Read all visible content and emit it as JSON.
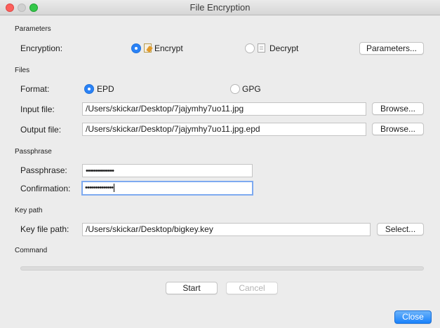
{
  "window": {
    "title": "File Encryption"
  },
  "parameters": {
    "section_label": "Parameters",
    "encryption_label": "Encryption:",
    "encrypt_option": "Encrypt",
    "decrypt_option": "Decrypt",
    "selected": "Encrypt",
    "parameters_button": "Parameters..."
  },
  "files": {
    "section_label": "Files",
    "format_label": "Format:",
    "format_options": [
      "EPD",
      "GPG"
    ],
    "format_selected": "EPD",
    "input_label": "Input file:",
    "input_value": "/Users/skickar/Desktop/7jajymhy7uo11.jpg",
    "input_browse": "Browse...",
    "output_label": "Output file:",
    "output_value": "/Users/skickar/Desktop/7jajymhy7uo11.jpg.epd",
    "output_browse": "Browse..."
  },
  "passphrase": {
    "section_label": "Passphrase",
    "passphrase_label": "Passphrase:",
    "passphrase_value": "••••••••••••••",
    "confirmation_label": "Confirmation:",
    "confirmation_value": "••••••••••••••"
  },
  "key_path": {
    "section_label": "Key path",
    "key_file_label": "Key file path:",
    "key_file_value": "/Users/skickar/Desktop/bigkey.key",
    "select_button": "Select..."
  },
  "command": {
    "section_label": "Command",
    "progress": 0,
    "start_button": "Start",
    "cancel_button": "Cancel"
  },
  "footer": {
    "close_button": "Close"
  },
  "colors": {
    "accent": "#2a82f6",
    "focus_ring": "#7eaaf0",
    "close_red": "#fc605c",
    "maximize_green": "#34c84a"
  }
}
